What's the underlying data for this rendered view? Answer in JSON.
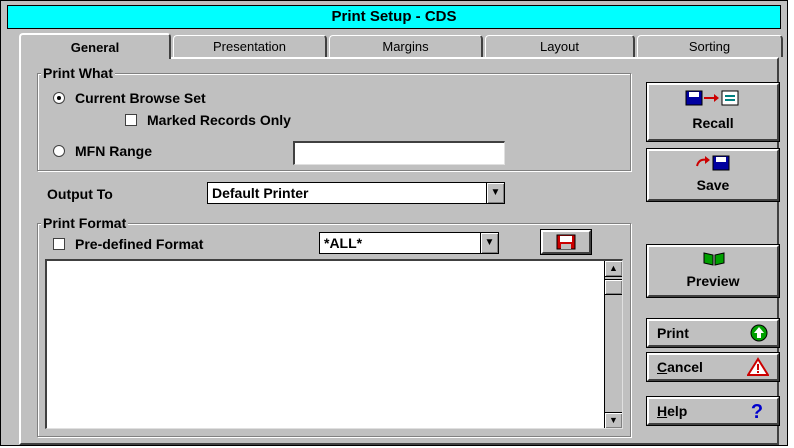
{
  "window": {
    "title": "Print Setup - CDS"
  },
  "tabs": [
    {
      "label": "General",
      "active": true
    },
    {
      "label": "Presentation"
    },
    {
      "label": "Margins"
    },
    {
      "label": "Layout"
    },
    {
      "label": "Sorting"
    }
  ],
  "print_what": {
    "legend": "Print What",
    "current_browse_set": "Current Browse Set",
    "current_browse_set_selected": true,
    "marked_records_only": "Marked Records Only",
    "marked_records_checked": false,
    "mfn_range": "MFN Range",
    "mfn_range_value": ""
  },
  "output_to": {
    "label": "Output To",
    "value": "Default Printer"
  },
  "print_format": {
    "legend": "Print Format",
    "predefined": "Pre-defined Format",
    "predefined_checked": false,
    "format_value": "*ALL*",
    "format_text": ""
  },
  "buttons": {
    "recall": "Recall",
    "save": "Save",
    "preview": "Preview",
    "print": "Print",
    "cancel": "Cancel",
    "help": "Help"
  },
  "colors": {
    "title_bar": "#00ffff",
    "dialog_face": "#c0c0c0",
    "print_icon": "#00a000",
    "cancel_icon": "#cc0000",
    "help_icon": "#0000cc",
    "disk_icon": "#0000a0"
  }
}
